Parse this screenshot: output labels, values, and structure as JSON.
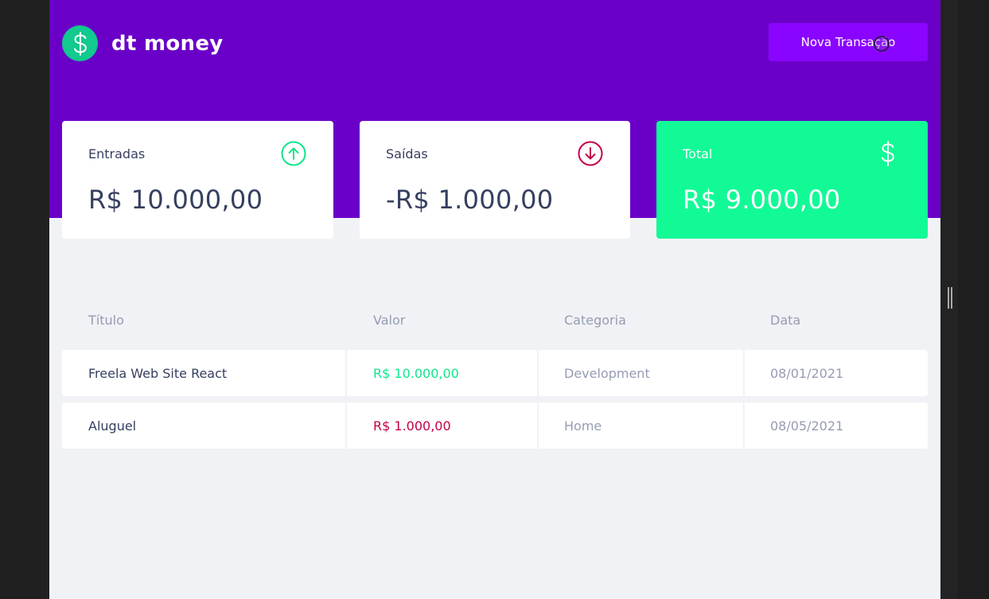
{
  "header": {
    "app_name": "dt money",
    "new_transaction_label": "Nova Transação"
  },
  "summary": {
    "income": {
      "label": "Entradas",
      "amount": "R$ 10.000,00",
      "icon": "arrow-up-circle-icon"
    },
    "outcome": {
      "label": "Saídas",
      "amount": "-R$ 1.000,00",
      "icon": "arrow-down-circle-icon"
    },
    "total": {
      "label": "Total",
      "amount": "R$ 9.000,00",
      "icon": "dollar-icon"
    }
  },
  "table": {
    "headers": [
      "Título",
      "Valor",
      "Categoria",
      "Data"
    ],
    "rows": [
      {
        "title": "Freela Web Site React",
        "value": "R$ 10.000,00",
        "type": "deposit",
        "category": "Development",
        "date": "08/01/2021"
      },
      {
        "title": "Aluguel",
        "value": "R$ 1.000,00",
        "type": "withdraw",
        "category": "Home",
        "date": "08/05/2021"
      }
    ]
  },
  "colors": {
    "header_bg": "#6a00c8",
    "button_bg": "#8a05ff",
    "total_card_bg": "#12fa96",
    "deposit": "#12e58b",
    "withdraw": "#c3004a",
    "text": "#363f5f",
    "muted": "#969cb3",
    "page_bg": "#f0f2f5"
  }
}
